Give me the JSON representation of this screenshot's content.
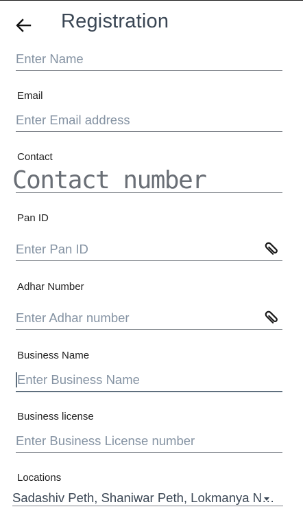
{
  "app_bar": {
    "title": "Registration"
  },
  "form": {
    "name": {
      "placeholder": "Enter Name"
    },
    "email": {
      "label": "Email",
      "placeholder": "Enter Email address"
    },
    "contact": {
      "label": "Contact",
      "placeholder": "Contact number"
    },
    "pan": {
      "label": "Pan ID",
      "placeholder": "Enter Pan ID"
    },
    "adhar": {
      "label": "Adhar Number",
      "placeholder": "Enter Adhar number"
    },
    "business_name": {
      "label": "Business Name",
      "placeholder": "Enter Business Name"
    },
    "business_license": {
      "label": "Business license",
      "placeholder": "Enter Business License number"
    },
    "locations": {
      "label": "Locations",
      "value": "Sadashiv Peth, Shaniwar Peth, Lokmanya Nagar"
    }
  },
  "icons": {
    "back": "arrow-left-icon",
    "attach": "paperclip-icon",
    "dropdown": "chevron-down-icon"
  },
  "colors": {
    "title": "#3a4654",
    "placeholder": "#8593a3",
    "underline": "#7a7f86"
  }
}
